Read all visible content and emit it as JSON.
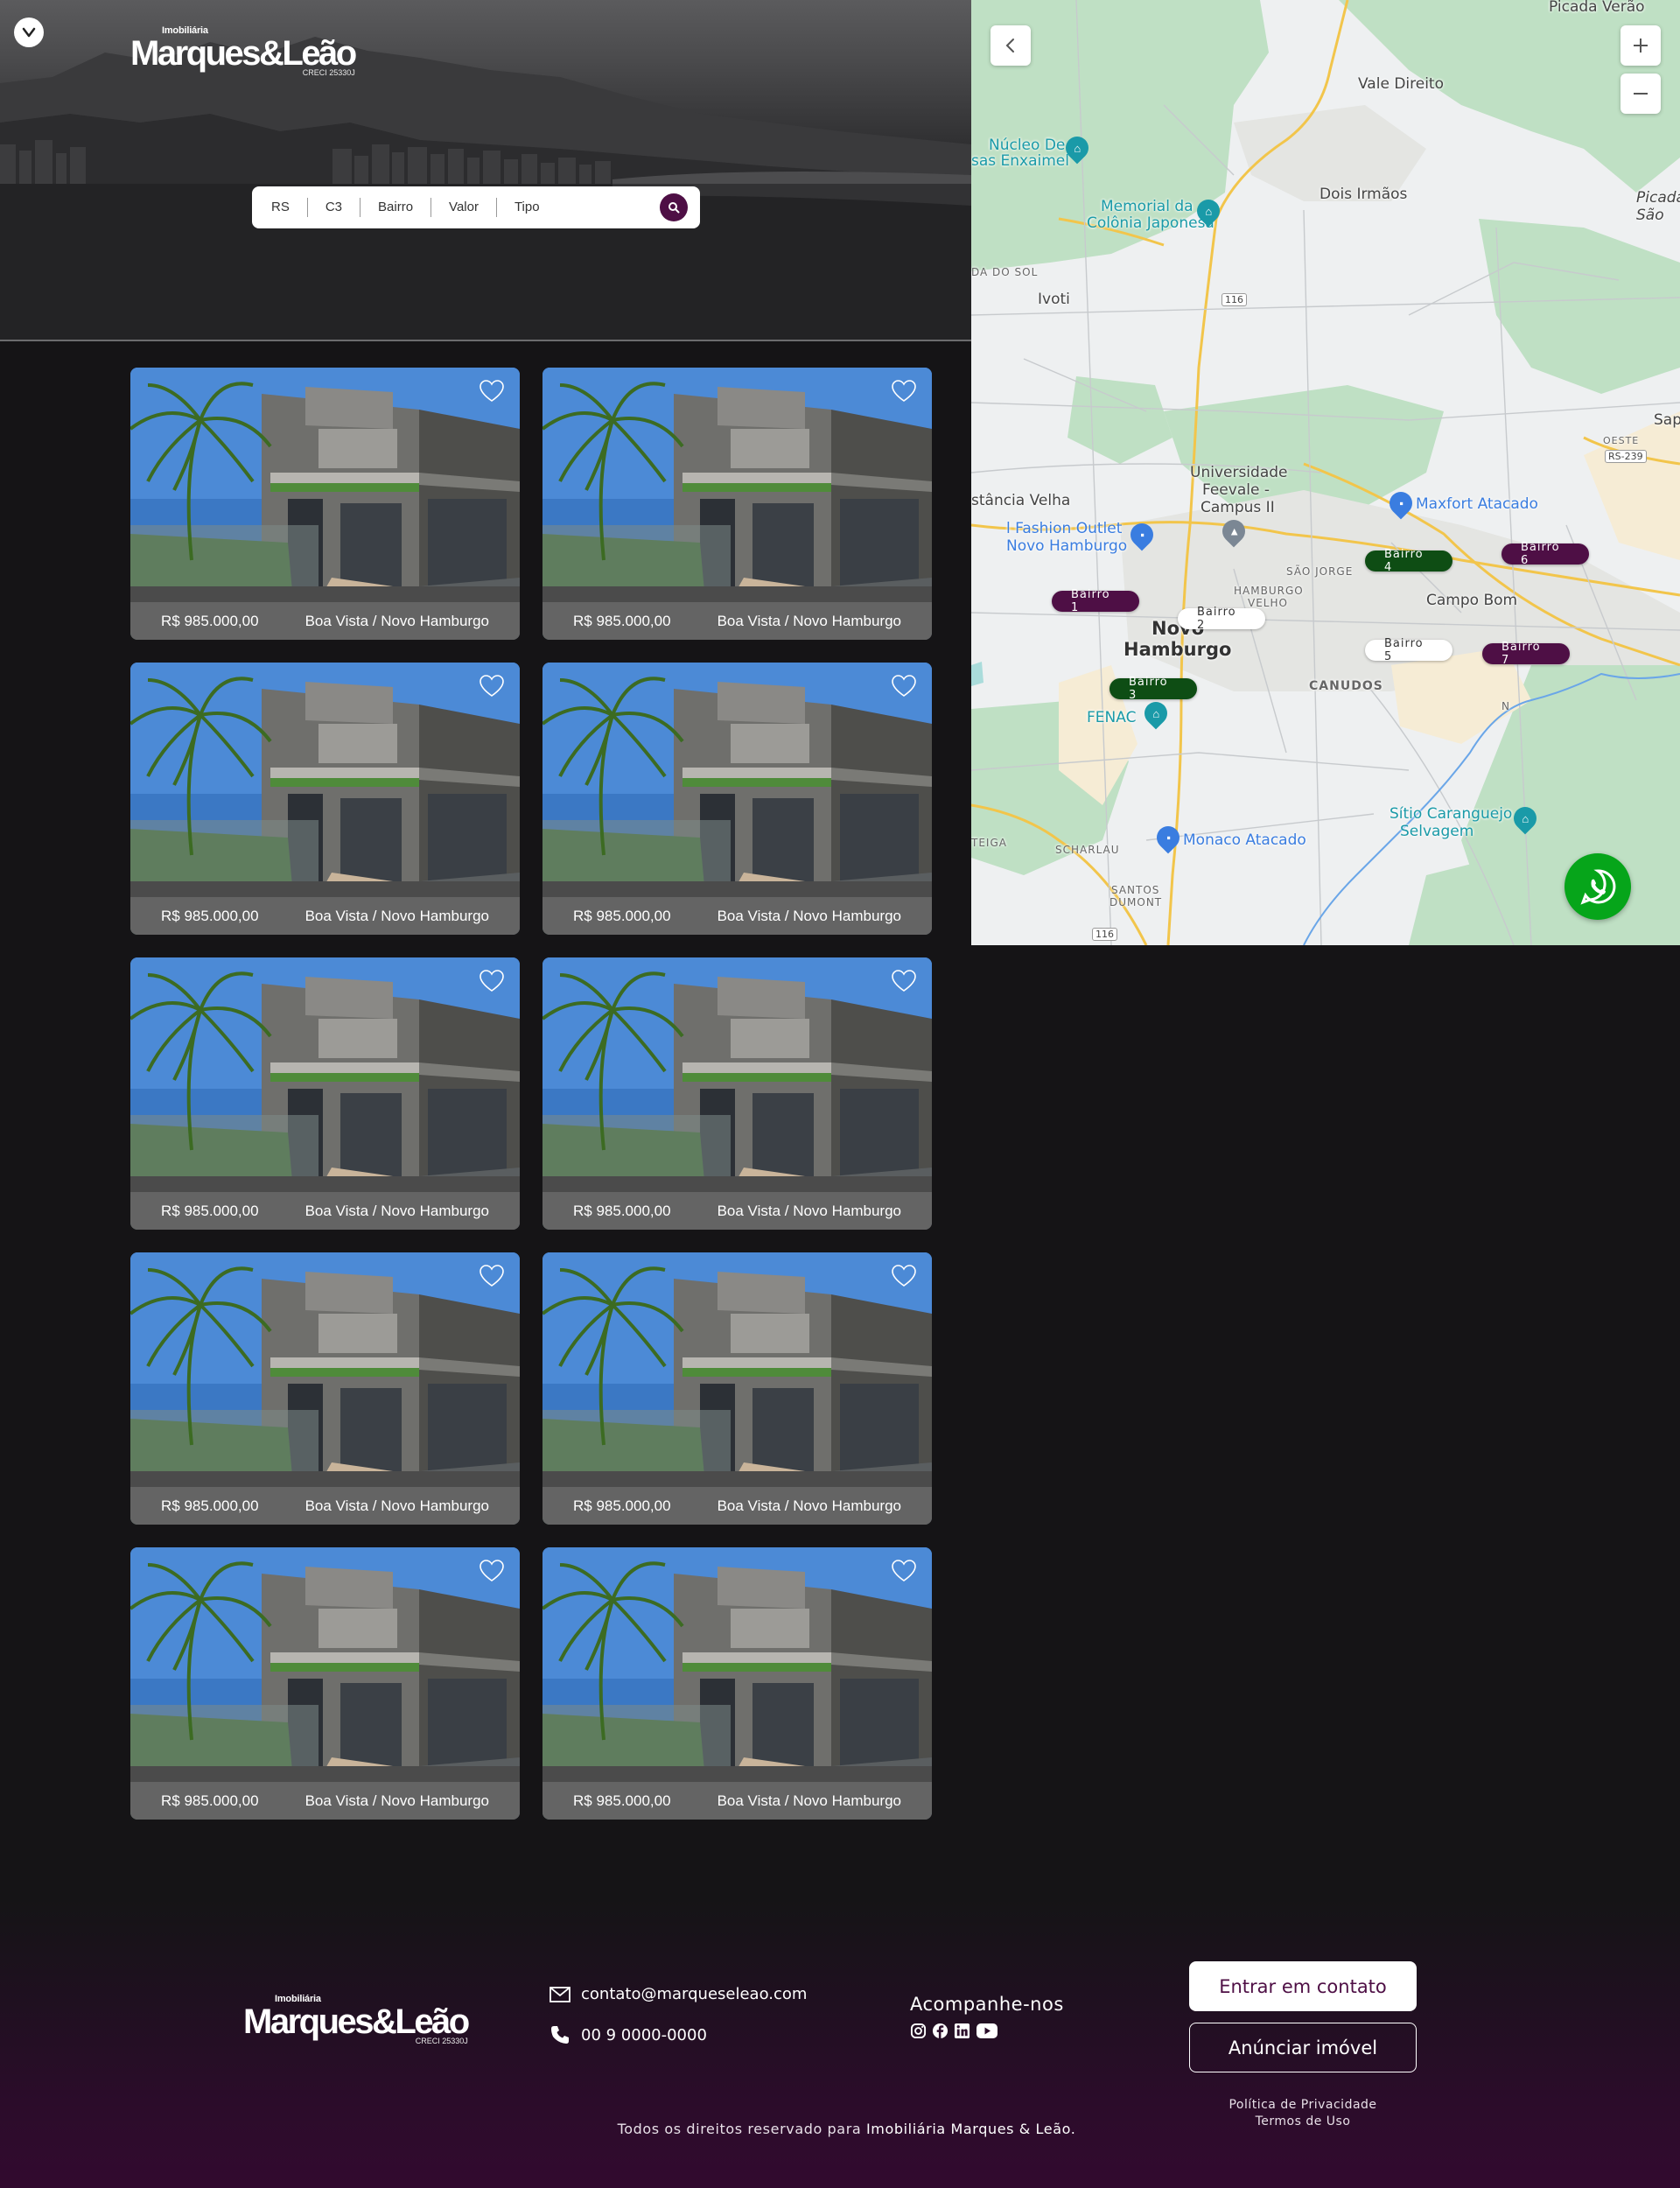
{
  "header": {
    "logo": {
      "small": "Imobiliária",
      "name": "Marques&Leão",
      "creci": "CRECI 25330J"
    }
  },
  "search": {
    "fields": [
      "RS",
      "C3",
      "Bairro",
      "Valor",
      "Tipo"
    ]
  },
  "map": {
    "labels": {
      "vale_direito": "Vale Direito",
      "picada_verao": "Picada Verão",
      "picada_sao": "Picada São",
      "nucleo": "Núcleo De",
      "casas_enxaimel": "sas Enxaimel",
      "memorial": "Memorial da",
      "colonia": "Colônia Japonesa",
      "dois_irmaos": "Dois Irmãos",
      "da_do_sol": "DA DO SOL",
      "ivoti": "Ivoti",
      "sap": "Sap",
      "oeste": "OESTE",
      "rs239": "RS-239",
      "estancia_velha": "stância Velha",
      "universidade": "Universidade",
      "feevale": "Feevale -",
      "campus": "Campus II",
      "maxfort": "Maxfort Atacado",
      "fashion1": "l Fashion Outlet",
      "fashion2": "Novo Hamburgo",
      "sao_jorge": "SÃO JORGE",
      "hamburgo_velho1": "HAMBURGO",
      "hamburgo_velho2": "VELHO",
      "campo_bom": "Campo Bom",
      "novo": "Novo",
      "hamburgo": "Hamburgo",
      "canudos": "CANUDOS",
      "fenac": "FENAC",
      "sitio1": "Sítio Caranguejo",
      "sitio2": "Selvagem",
      "monaco": "Monaco Atacado",
      "scharlau": "SCHARLAU",
      "santos1": "SANTOS",
      "santos2": "DUMONT",
      "teiga": "TEIGA",
      "route116a": "116",
      "route116b": "116",
      "n": "N"
    },
    "pins": [
      {
        "label": "Bairro 1",
        "style": "purple"
      },
      {
        "label": "Bairro 2",
        "style": "white"
      },
      {
        "label": "Bairro 3",
        "style": "green"
      },
      {
        "label": "Bairro 4",
        "style": "green"
      },
      {
        "label": "Bairro 5",
        "style": "white"
      },
      {
        "label": "Bairro 6",
        "style": "purple"
      },
      {
        "label": "Bairro 7",
        "style": "purple"
      }
    ]
  },
  "listings": [
    {
      "price": "R$ 985.000,00",
      "location": "Boa Vista / Novo Hamburgo"
    },
    {
      "price": "R$ 985.000,00",
      "location": "Boa Vista / Novo Hamburgo"
    },
    {
      "price": "R$ 985.000,00",
      "location": "Boa Vista / Novo Hamburgo"
    },
    {
      "price": "R$ 985.000,00",
      "location": "Boa Vista / Novo Hamburgo"
    },
    {
      "price": "R$ 985.000,00",
      "location": "Boa Vista / Novo Hamburgo"
    },
    {
      "price": "R$ 985.000,00",
      "location": "Boa Vista / Novo Hamburgo"
    },
    {
      "price": "R$ 985.000,00",
      "location": "Boa Vista / Novo Hamburgo"
    },
    {
      "price": "R$ 985.000,00",
      "location": "Boa Vista / Novo Hamburgo"
    },
    {
      "price": "R$ 985.000,00",
      "location": "Boa Vista / Novo Hamburgo"
    },
    {
      "price": "R$ 985.000,00",
      "location": "Boa Vista / Novo Hamburgo"
    }
  ],
  "footer": {
    "logo": {
      "small": "Imobiliária",
      "name": "Marques&Leão",
      "creci": "CRECI 25330J"
    },
    "email": "contato@marqueseleao.com",
    "phone": "00 9 0000-0000",
    "follow_title": "Acompanhe-nos",
    "contact_button": "Entrar em contato",
    "announce_button": "Anúnciar imóvel",
    "privacy": "Política de Privacidade",
    "terms": "Termos de Uso",
    "copyright_prefix": "Todos os direitos reservado para",
    "copyright_brand": "Imobiliária Marques & Leão."
  },
  "colors": {
    "brand_purple": "#4e0f45",
    "brand_green": "#0e4d14",
    "whatsapp_green": "#06a51a",
    "background": "#151416"
  }
}
